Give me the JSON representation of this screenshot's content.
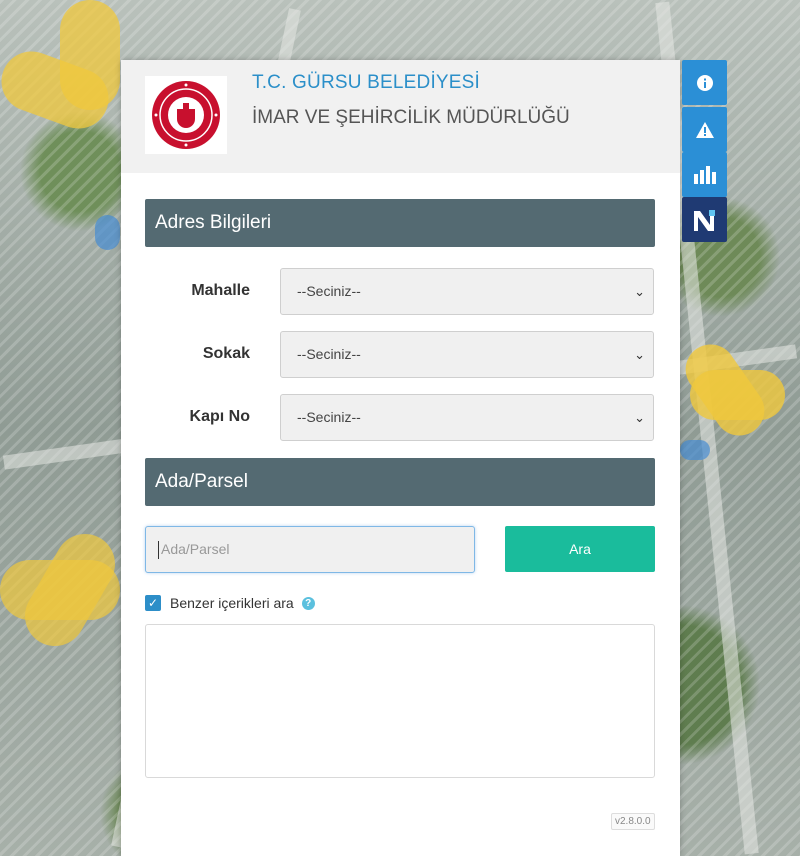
{
  "header": {
    "title": "T.C. GÜRSU BELEDİYESİ",
    "subtitle": "İMAR VE ŞEHİRCİLİK MÜDÜRLÜĞÜ",
    "logo": {
      "text_top": "GÜRSU BELEDİYESİ",
      "year": "1930"
    }
  },
  "address": {
    "heading": "Adres Bilgileri",
    "fields": [
      {
        "label": "Mahalle",
        "value": "--Seciniz--"
      },
      {
        "label": "Sokak",
        "value": "--Seciniz--"
      },
      {
        "label": "Kapı No",
        "value": "--Seciniz--"
      }
    ]
  },
  "parcel": {
    "heading": "Ada/Parsel",
    "placeholder": "Ada/Parsel",
    "search_button": "Ara",
    "similar_label": "Benzer içerikleri ara",
    "similar_checked": true
  },
  "version": "v2.8.0.0",
  "side_buttons": [
    {
      "icon": "info-icon",
      "color": "#2b8fd6"
    },
    {
      "icon": "warning-icon",
      "color": "#2b8fd6"
    },
    {
      "icon": "bar-chart-icon",
      "color": "#2b8fd6"
    },
    {
      "icon": "netcad-logo-icon",
      "color": "#1f3a73"
    }
  ],
  "colors": {
    "accent": "#2b8fc9",
    "section": "#546a72",
    "search": "#1abc9c"
  }
}
